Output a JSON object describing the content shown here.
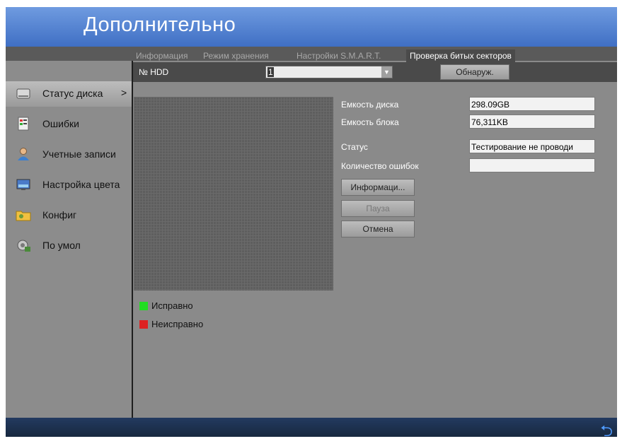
{
  "title": "Дополнительно",
  "sidebar": {
    "items": [
      {
        "label": "Статус диска",
        "icon": "hdd-icon",
        "arrow": ">"
      },
      {
        "label": "Ошибки",
        "icon": "error-log-icon"
      },
      {
        "label": "Учетные записи",
        "icon": "user-icon"
      },
      {
        "label": "Настройка цвета",
        "icon": "monitor-color-icon"
      },
      {
        "label": "Конфиг",
        "icon": "folder-config-icon"
      },
      {
        "label": "По умол",
        "icon": "restore-default-icon"
      }
    ]
  },
  "tabs": [
    {
      "label": "Информация"
    },
    {
      "label": "Режим хранения"
    },
    {
      "label": "Настройки S.M.A.R.T."
    },
    {
      "label": "Проверка битых секторов"
    }
  ],
  "hdd": {
    "label": "№ HDD",
    "value": "1",
    "detect_button": "Обнаруж."
  },
  "info": {
    "disk_capacity_label": "Емкость диска",
    "disk_capacity_value": "298.09GB",
    "block_capacity_label": "Емкость блока",
    "block_capacity_value": "76,311KB",
    "status_label": "Статус",
    "status_value": "Тестирование не проводи",
    "error_count_label": "Количество ошибок",
    "error_count_value": ""
  },
  "buttons": {
    "info": "Информаци...",
    "pause": "Пауза",
    "cancel": "Отмена"
  },
  "legend": [
    {
      "label": "Исправно",
      "color": "#22dd22"
    },
    {
      "label": "Неисправно",
      "color": "#dd2222"
    }
  ],
  "colors": {
    "accent": "#4f7fd6",
    "bottom_bar": "#1c2f4c"
  }
}
